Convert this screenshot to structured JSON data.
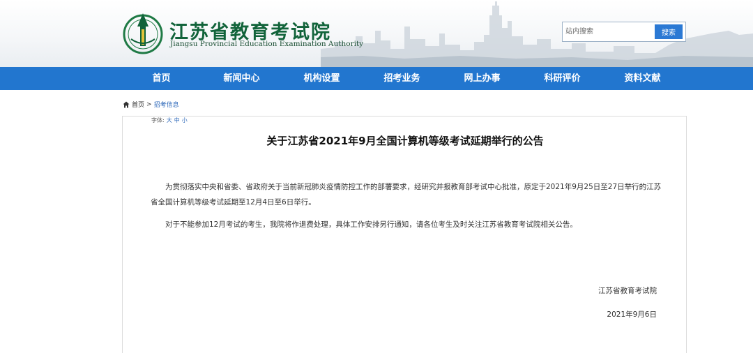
{
  "header": {
    "title": "江苏省教育考试院",
    "subtitle": "Jiangsu Provincial Education Examination Authority",
    "logo_icon": "school-crest-icon",
    "brand_color": "#11633a"
  },
  "search": {
    "placeholder": "站内搜索",
    "button_label": "搜索"
  },
  "nav": {
    "color": "#2276cf",
    "items": [
      {
        "label": "首页"
      },
      {
        "label": "新闻中心"
      },
      {
        "label": "机构设置"
      },
      {
        "label": "招考业务"
      },
      {
        "label": "网上办事"
      },
      {
        "label": "科研评价"
      },
      {
        "label": "资料文献"
      }
    ]
  },
  "breadcrumb": {
    "home_icon": "home-icon",
    "home": "首页",
    "separator": ">",
    "current": "招考信息"
  },
  "font_size": {
    "label": "字体:",
    "large": "大",
    "medium": "中",
    "small": "小"
  },
  "article": {
    "title": "关于江苏省2021年9月全国计算机等级考试延期举行的公告",
    "paragraphs": [
      "为贯彻落实中央和省委、省政府关于当前新冠肺炎疫情防控工作的部署要求，经研究并报教育部考试中心批准，原定于2021年9月25日至27日举行的江苏省全国计算机等级考试延期至12月4日至6日举行。",
      "对于不能参加12月考试的考生，我院将作退费处理，具体工作安排另行通知，请各位考生及时关注江苏省教育考试院相关公告。"
    ],
    "signature": "江苏省教育考试院",
    "date": "2021年9月6日"
  }
}
